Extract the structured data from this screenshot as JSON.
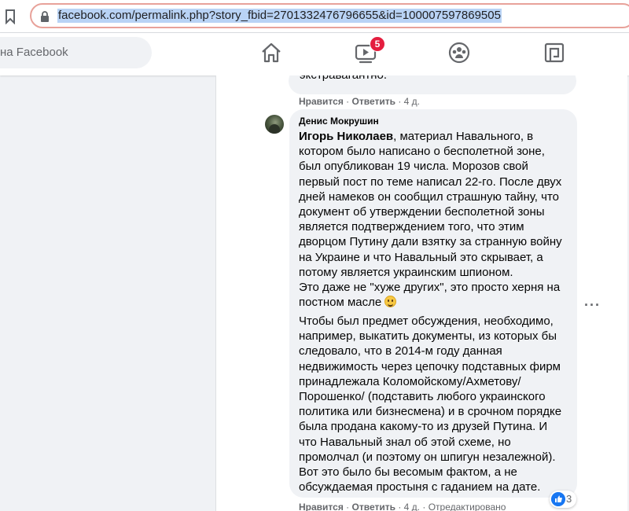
{
  "browser": {
    "url": "facebook.com/permalink.php?story_fbid=2701332476796655&id=100007597869505"
  },
  "header": {
    "search_placeholder": "на Facebook",
    "video_badge": "5",
    "nav_icons": [
      "home-icon",
      "video-icon",
      "groups-icon",
      "gaming-icon"
    ]
  },
  "previous_comment": {
    "text_tail": "экстравагантно.",
    "like": "Нравится",
    "reply": "Ответить",
    "time": "4 д."
  },
  "comment": {
    "author": "Денис Мокрушин",
    "mention": "Игорь Николаев",
    "lines_p1": [
      ", материал Навального, в",
      "котором было написано о бесполетной зоне,",
      "был опубликован 19 числа. Морозов свой",
      "первый пост по теме написал 22-го. После двух",
      "дней намеков он сообщил страшную тайну, что",
      "документ об утверждении бесполетной зоны",
      "является подтверждением того, что этим",
      "дворцом Путину дали взятку за странную войну",
      "на Украине и что Навальный это скрывает, а",
      "потому является украинским шпионом.",
      "Это даже не \"хуже других\", это просто херня на",
      "постном масле"
    ],
    "lines_p2": [
      "Чтобы был предмет обсуждения, необходимо,",
      "например, выкатить документы, из которых бы",
      "следовало, что в 2014-м году данная",
      "недвижимость через цепочку подставных фирм",
      "принадлежала Коломойскому/Ахметову/",
      "Порошенко/ (подставить любого украинского",
      "политика или бизнесмена) и в срочном порядке",
      "была продана какому-то из друзей Путина. И",
      "что Навальный знал об этой схеме, но",
      "промолчал (и поэтому он шпигун незалежной).",
      "Вот это было бы весомым фактом, а не",
      "обсуждаемая простыня с гаданием на дате."
    ],
    "like": "Нравится",
    "reply": "Ответить",
    "time": "4 д.",
    "edited": "Отредактировано",
    "reaction_count": "3",
    "more_label": "···"
  }
}
